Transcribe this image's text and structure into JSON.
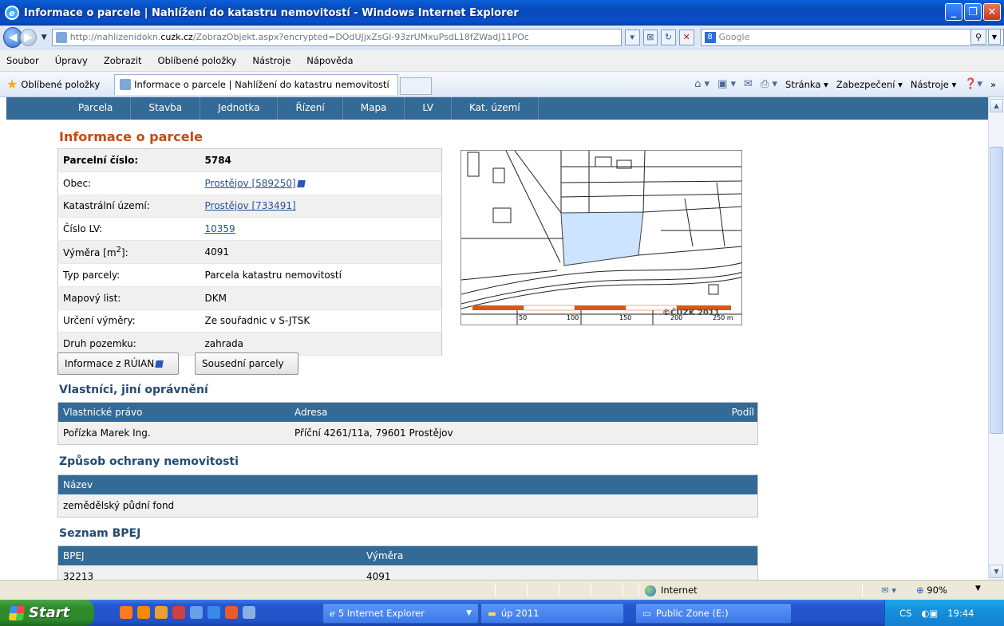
{
  "window": {
    "title": "Informace o parcele | Nahlížení do katastru nemovitostí - Windows Internet Explorer"
  },
  "address": {
    "url_prefix": "http://nahlizenidokn.",
    "url_domain": "cuzk.cz",
    "url_rest": "/ZobrazObjekt.aspx?encrypted=DOdUJjxZsGI-93zrUMxuPsdL18fZWadJ11POc",
    "search_placeholder": "Google"
  },
  "menu": [
    "Soubor",
    "Úpravy",
    "Zobrazit",
    "Oblíbené položky",
    "Nástroje",
    "Nápověda"
  ],
  "favorites": {
    "label": "Oblíbené položky",
    "tab_title": "Informace o parcele | Nahlížení do katastru nemovitostí",
    "page_menu": "Stránka ▾",
    "security_menu": "Zabezpečení ▾",
    "tools_menu": "Nástroje ▾"
  },
  "topnav": [
    "Parcela",
    "Stavba",
    "Jednotka",
    "Řízení",
    "Mapa",
    "LV",
    "Kat. území"
  ],
  "page": {
    "title": "Informace o parcele",
    "rows": [
      {
        "key": "Parcelní číslo:",
        "value": "5784"
      },
      {
        "key": "Obec:",
        "value": "Prostějov [589250]"
      },
      {
        "key": "Katastrální území:",
        "value": "Prostějov [733491]"
      },
      {
        "key": "Číslo LV:",
        "value": "10359"
      },
      {
        "key": "Výměra [m",
        "key_sup": "2",
        "key_end": "]:",
        "value": "4091"
      },
      {
        "key": "Typ parcely:",
        "value": "Parcela katastru nemovitostí"
      },
      {
        "key": "Mapový list:",
        "value": "DKM"
      },
      {
        "key": "Určení výměry:",
        "value": "Ze souřadnic v S-JTSK"
      },
      {
        "key": "Druh pozemku:",
        "value": "zahrada"
      }
    ],
    "map_scale": [
      "50",
      "100",
      "150",
      "200",
      "250 m"
    ],
    "map_copyright": "©ČUZK 2011",
    "btn_ruian": "Informace z RÚIAN",
    "btn_neighbors": "Sousední parcely"
  },
  "owners": {
    "heading": "Vlastníci, jiní oprávnění",
    "col_right": "Vlastnické právo",
    "col_address": "Adresa",
    "col_share": "Podíl",
    "rows": [
      {
        "name": "Pořízka Marek Ing.",
        "address": "Příční 4261/11a, 79601 Prostějov"
      }
    ]
  },
  "protection": {
    "heading": "Způsob ochrany nemovitosti",
    "col_name": "Název",
    "rows": [
      "zemědělský půdní fond"
    ]
  },
  "bpej": {
    "heading": "Seznam BPEJ",
    "col_bpej": "BPEJ",
    "col_area": "Výměra",
    "rows": [
      {
        "bpej": "32213",
        "area": "4091"
      }
    ]
  },
  "status": {
    "zone": "Internet",
    "zoom": "90%"
  },
  "taskbar": {
    "start": "Start",
    "ie": "5 Internet Explorer",
    "folder": "úp 2011",
    "drive": "Public Zone (E:)",
    "lang": "CS",
    "time": "19:44"
  },
  "colors": {
    "nav": "#336a96",
    "title": "#c54a10",
    "heading": "#244a73",
    "parcel_fill": "#cce4ff"
  }
}
